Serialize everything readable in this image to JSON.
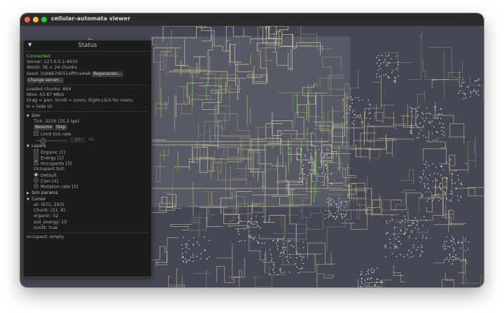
{
  "window": {
    "title": "cellular-automata viewer"
  },
  "panel": {
    "title": "Status",
    "status": "Connected",
    "server": "Server: 127.0.0.1:4433",
    "world": "World: 36 × 24 chunks",
    "seed_label": "Seed: 0xbbb7d551eff0ca4e8",
    "regenerate_label": "Regenerate...",
    "change_server_label": "Change server...",
    "loaded_chunks": "Loaded chunks: 864",
    "wire": "Wire: 43.87 MB/s",
    "help_drag": "Drag = pan, Scroll = zoom, Right-click for menu",
    "help_hide": "H = hide UI",
    "sim": {
      "heading": "Sim",
      "tick": "Tick: 2216  (25.2 tps)",
      "resume_label": "Resume",
      "step_label": "Step",
      "limit_label": "Limit tick rate",
      "limit_checked": false,
      "rate_value": "10",
      "rate_unit": "Hz"
    },
    "layers": {
      "heading": "Layers",
      "items": [
        {
          "label": "Organic [1]",
          "checked": false
        },
        {
          "label": "Energy [2]",
          "checked": false
        },
        {
          "label": "Occupants [3]",
          "checked": true
        }
      ],
      "tint_label": "Occupant tint:",
      "tints": [
        {
          "label": "Default",
          "selected": true
        },
        {
          "label": "Clan [4]",
          "selected": false
        },
        {
          "label": "Mutation rate [5]",
          "selected": false
        }
      ]
    },
    "sim_params": {
      "heading": "Sim params"
    },
    "cursor": {
      "heading": "Cursor",
      "at": "at: (672, 293)",
      "chunk": "Chunk: (21, 9)",
      "organic": "organic: 52",
      "soil": "soil_energy: 10",
      "sunlit": "sunlit: true",
      "occupant": "occupant: empty"
    }
  },
  "colors": {
    "background": "#454854",
    "accent_green": "#7ccf5b",
    "wire_tan": "#c8c09a"
  }
}
